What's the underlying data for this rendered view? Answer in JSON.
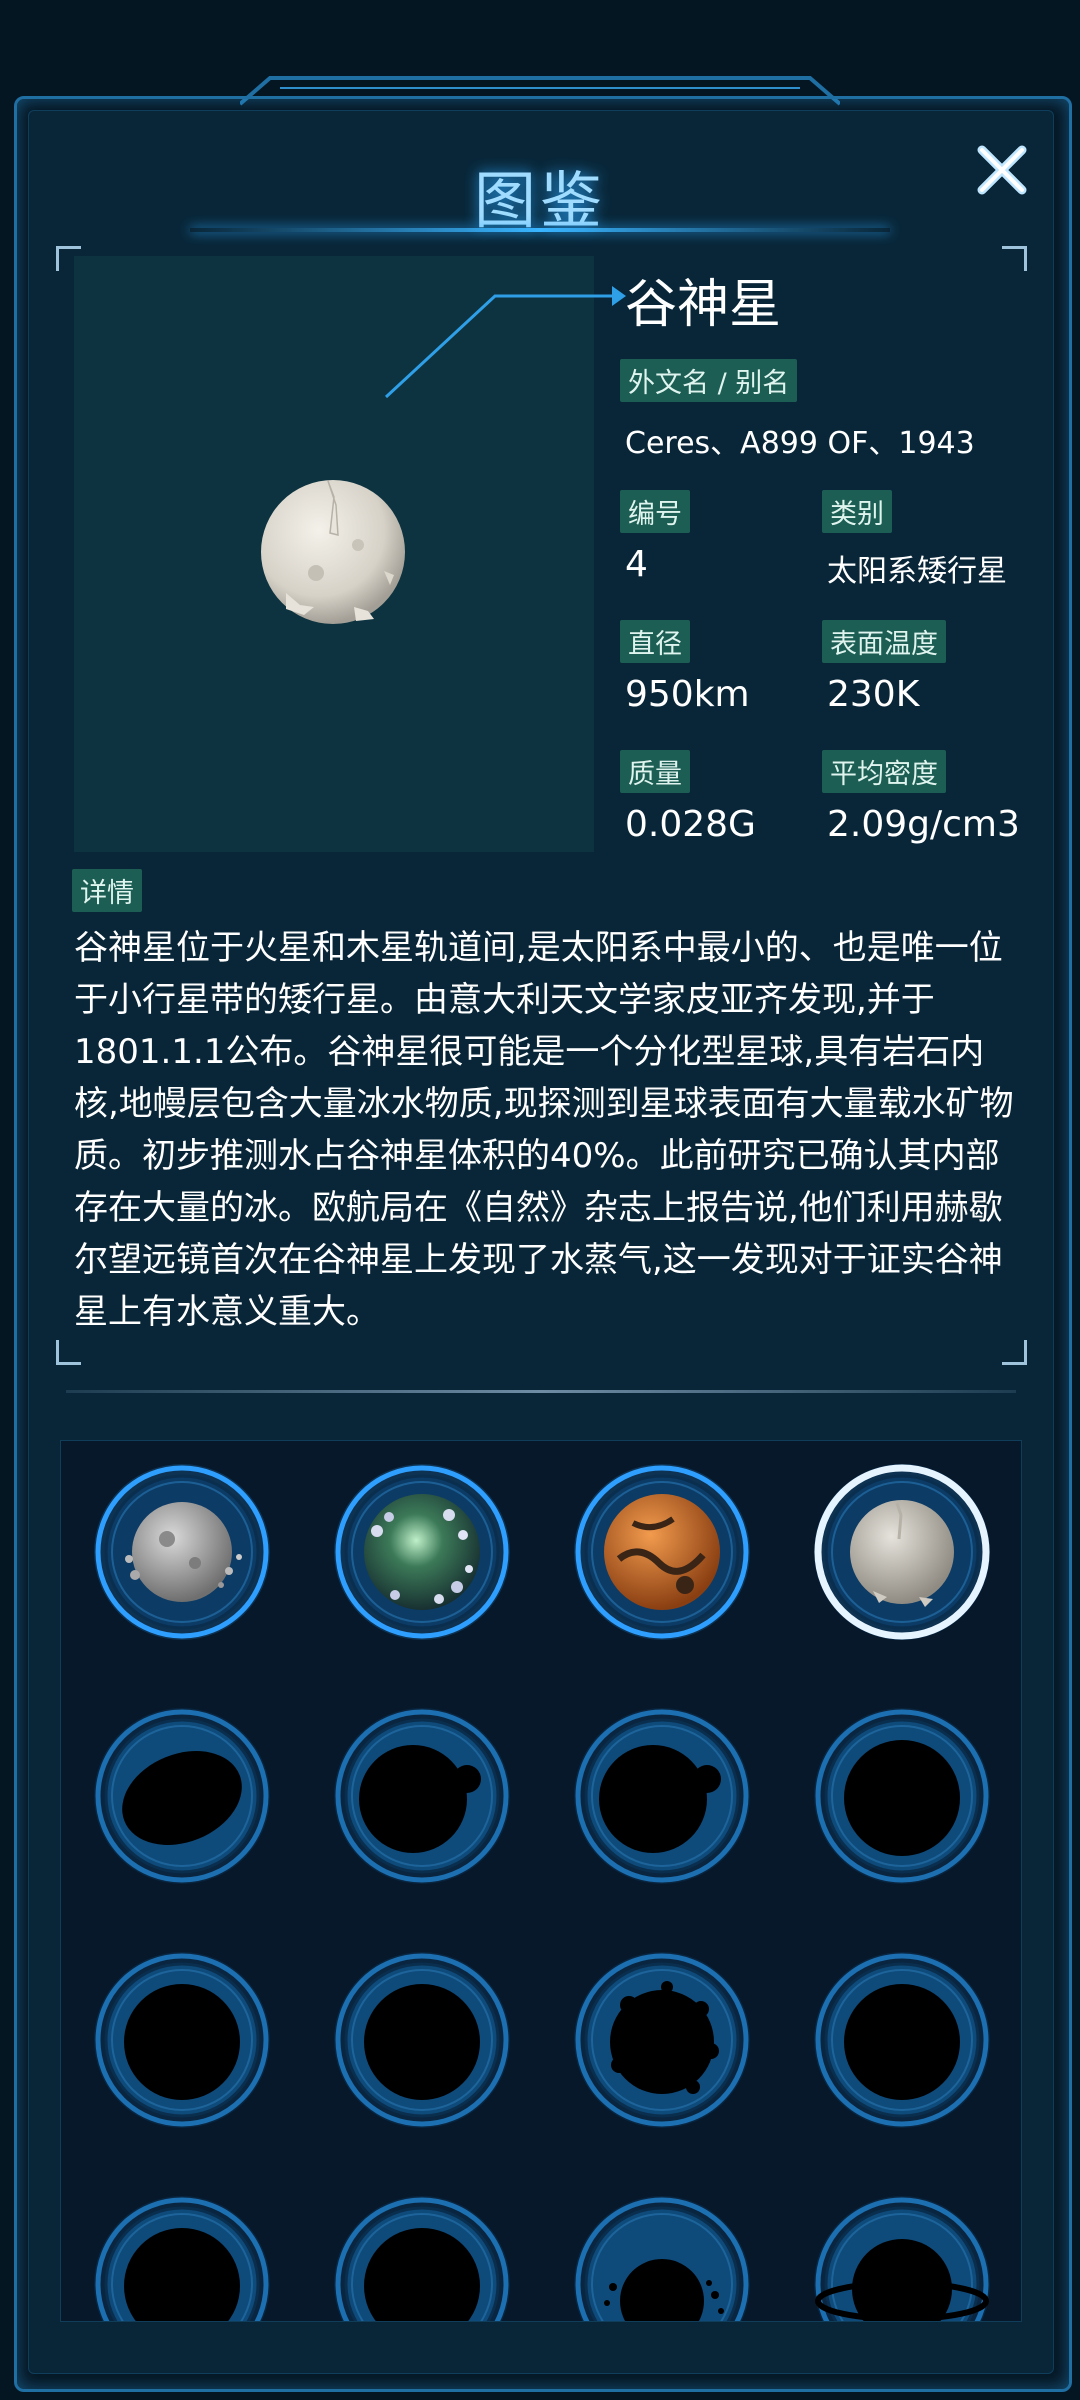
{
  "header": {
    "title": "图鉴"
  },
  "planet": {
    "name": "谷神星",
    "alias_label": "外文名 / 别名",
    "alias_value": "Ceres、A899 OF、1943",
    "number_label": "编号",
    "number_value": "4",
    "category_label": "类别",
    "category_value": "太阳系矮行星",
    "diameter_label": "直径",
    "diameter_value": "950km",
    "surface_temp_label": "表面温度",
    "surface_temp_value": "230K",
    "mass_label": "质量",
    "mass_value": "0.028G",
    "density_label": "平均密度",
    "density_value": "2.09g/cm3",
    "details_label": "详情",
    "description": "谷神星位于火星和木星轨道间,是太阳系中最小的、也是唯一位于小行星带的矮行星。由意大利天文学家皮亚齐发现,并于1801.1.1公布。谷神星很可能是一个分化型星球,具有岩石内核,地幔层包含大量冰水物质,现探测到星球表面有大量载水矿物质。初步推测水占谷神星体积的40%。此前研究已确认其内部存在大量的冰。欧航局在《自然》杂志上报告说,他们利用赫歇尔望远镜首次在谷神星上发现了水蒸气,这一发现对于证实谷神星上有水意义重大。"
  },
  "colors": {
    "accent": "#39b4ff",
    "tag_bg": "#1c5e54",
    "panel_bg": "#092638"
  },
  "collection": [
    {
      "icon": "rocky-asteroid-icon",
      "unlocked": true,
      "selected": false
    },
    {
      "icon": "green-glow-planet-icon",
      "unlocked": true,
      "selected": false
    },
    {
      "icon": "orange-planet-icon",
      "unlocked": true,
      "selected": false
    },
    {
      "icon": "ceres-icon",
      "unlocked": true,
      "selected": true
    },
    {
      "icon": "oval-silhouette-icon",
      "unlocked": false,
      "selected": false
    },
    {
      "icon": "planet-with-moon-silhouette-icon",
      "unlocked": false,
      "selected": false
    },
    {
      "icon": "planet-with-moon-silhouette-icon",
      "unlocked": false,
      "selected": false
    },
    {
      "icon": "round-silhouette-icon",
      "unlocked": false,
      "selected": false
    },
    {
      "icon": "round-silhouette-icon",
      "unlocked": false,
      "selected": false
    },
    {
      "icon": "round-silhouette-icon",
      "unlocked": false,
      "selected": false
    },
    {
      "icon": "spiky-silhouette-icon",
      "unlocked": false,
      "selected": false
    },
    {
      "icon": "round-silhouette-icon",
      "unlocked": false,
      "selected": false
    },
    {
      "icon": "round-silhouette-icon",
      "unlocked": false,
      "selected": false
    },
    {
      "icon": "round-silhouette-icon",
      "unlocked": false,
      "selected": false
    },
    {
      "icon": "debris-silhouette-icon",
      "unlocked": false,
      "selected": false
    },
    {
      "icon": "ringed-silhouette-icon",
      "unlocked": false,
      "selected": false
    }
  ]
}
